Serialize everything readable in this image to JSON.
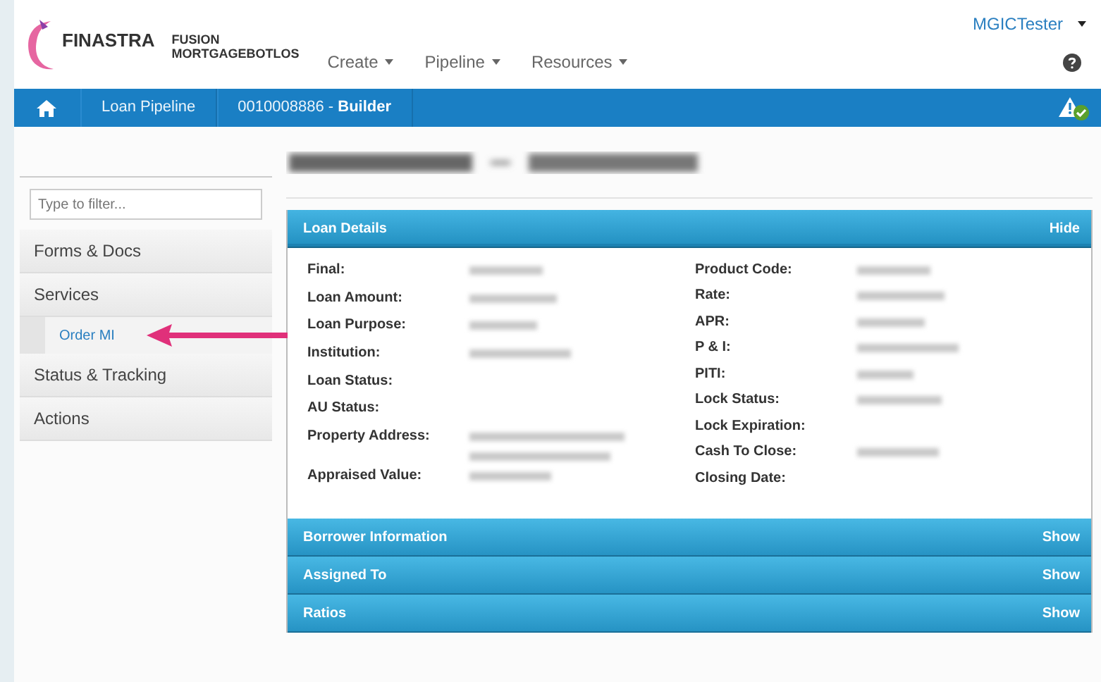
{
  "header": {
    "brand": "FINASTRA",
    "product_line_1": "FUSION",
    "product_line_2": "MORTGAGEBOTLOS",
    "menus": [
      {
        "label": "Create"
      },
      {
        "label": "Pipeline"
      },
      {
        "label": "Resources"
      }
    ],
    "user": "MGICTester"
  },
  "nav": {
    "crumbs": [
      {
        "label": "Loan Pipeline"
      },
      {
        "label": "0010008886 - **Builder**"
      }
    ]
  },
  "sidebar": {
    "filter_placeholder": "Type to filter...",
    "items": [
      {
        "label": "Forms & Docs"
      },
      {
        "label": "Services",
        "children": [
          {
            "label": "Order MI",
            "highlighted": true
          }
        ]
      },
      {
        "label": "Status & Tracking"
      },
      {
        "label": "Actions"
      }
    ]
  },
  "page": {
    "title_blurred": true,
    "panels": [
      {
        "title": "Loan Details",
        "toggle": "Hide",
        "expanded": true,
        "left_fields": [
          {
            "label": "Final:",
            "blurred": true
          },
          {
            "label": "Loan Amount:",
            "blurred": true
          },
          {
            "label": "Loan Purpose:",
            "blurred": true
          },
          {
            "label": "Institution:",
            "blurred": true
          },
          {
            "label": "Loan Status:",
            "blurred": false
          },
          {
            "label": "AU Status:",
            "blurred": false
          },
          {
            "label": "Property Address:",
            "blurred": true,
            "multiline": true
          },
          {
            "label": "Appraised Value:",
            "blurred": true
          }
        ],
        "right_fields": [
          {
            "label": "Product Code:",
            "blurred": true
          },
          {
            "label": "Rate:",
            "blurred": true
          },
          {
            "label": "APR:",
            "blurred": true
          },
          {
            "label": "P & I:",
            "blurred": true
          },
          {
            "label": "PITI:",
            "blurred": true
          },
          {
            "label": "Lock Status:",
            "blurred": true
          },
          {
            "label": "Lock Expiration:",
            "blurred": false
          },
          {
            "label": "Cash To Close:",
            "blurred": true
          },
          {
            "label": "Closing Date:",
            "blurred": false
          }
        ]
      },
      {
        "title": "Borrower Information",
        "toggle": "Show",
        "expanded": false
      },
      {
        "title": "Assigned To",
        "toggle": "Show",
        "expanded": false
      },
      {
        "title": "Ratios",
        "toggle": "Show",
        "expanded": false
      }
    ]
  }
}
